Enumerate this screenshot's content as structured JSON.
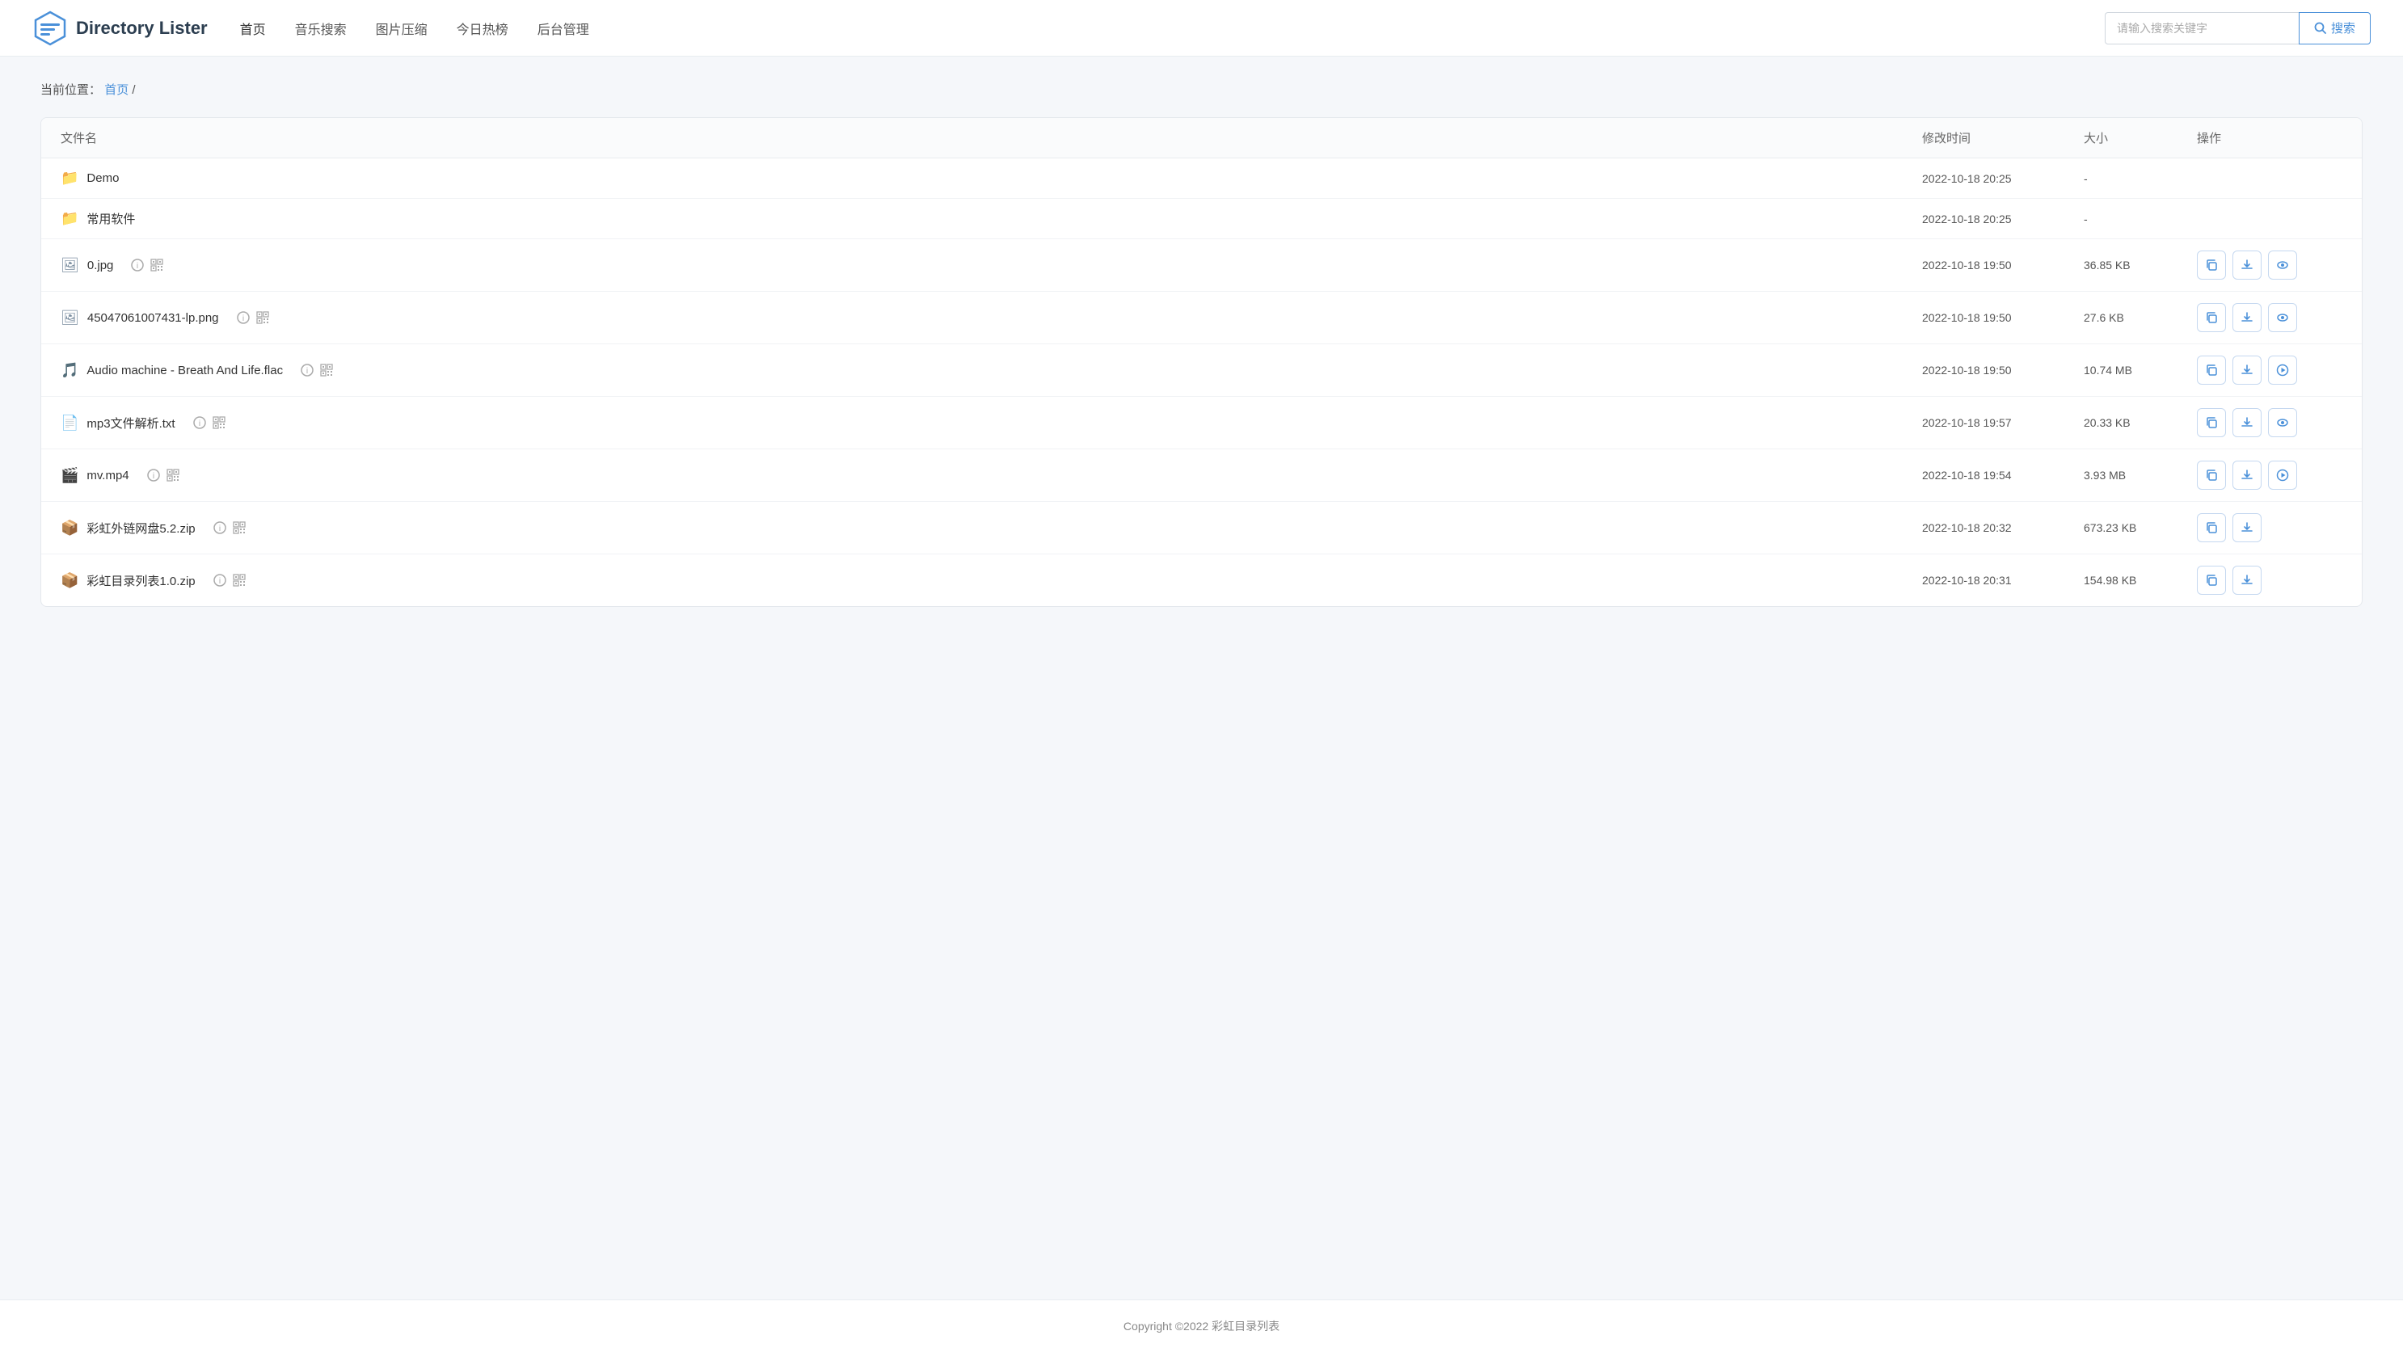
{
  "header": {
    "logo_text": "Directory Lister",
    "nav": {
      "items": [
        {
          "label": "首页",
          "active": true
        },
        {
          "label": "音乐搜索",
          "active": false
        },
        {
          "label": "图片压缩",
          "active": false
        },
        {
          "label": "今日热榜",
          "active": false
        },
        {
          "label": "后台管理",
          "active": false
        }
      ]
    },
    "search": {
      "placeholder": "请输入搜索关键字",
      "button_label": "搜索"
    }
  },
  "breadcrumb": {
    "prefix": "当前位置：",
    "home_link": "首页",
    "separator": " /"
  },
  "table": {
    "columns": {
      "name": "文件名",
      "modified": "修改时间",
      "size": "大小",
      "ops": "操作"
    },
    "rows": [
      {
        "type": "folder",
        "name": "Demo",
        "modified": "2022-10-18 20:25",
        "size": "-",
        "actions": []
      },
      {
        "type": "folder",
        "name": "常用软件",
        "modified": "2022-10-18 20:25",
        "size": "-",
        "actions": []
      },
      {
        "type": "image",
        "name": "0.jpg",
        "modified": "2022-10-18 19:50",
        "size": "36.85 KB",
        "actions": [
          "copy",
          "download",
          "preview"
        ]
      },
      {
        "type": "image",
        "name": "45047061007431-lp.png",
        "modified": "2022-10-18 19:50",
        "size": "27.6 KB",
        "actions": [
          "copy",
          "download",
          "preview"
        ]
      },
      {
        "type": "audio",
        "name": "Audio machine - Breath And Life.flac",
        "modified": "2022-10-18 19:50",
        "size": "10.74 MB",
        "actions": [
          "copy",
          "download",
          "play"
        ]
      },
      {
        "type": "text",
        "name": "mp3文件解析.txt",
        "modified": "2022-10-18 19:57",
        "size": "20.33 KB",
        "actions": [
          "copy",
          "download",
          "preview"
        ]
      },
      {
        "type": "video",
        "name": "mv.mp4",
        "modified": "2022-10-18 19:54",
        "size": "3.93 MB",
        "actions": [
          "copy",
          "download",
          "play"
        ]
      },
      {
        "type": "zip",
        "name": "彩虹外链网盘5.2.zip",
        "modified": "2022-10-18 20:32",
        "size": "673.23 KB",
        "actions": [
          "copy",
          "download"
        ]
      },
      {
        "type": "zip",
        "name": "彩虹目录列表1.0.zip",
        "modified": "2022-10-18 20:31",
        "size": "154.98 KB",
        "actions": [
          "copy",
          "download"
        ]
      }
    ]
  },
  "footer": {
    "text": "Copyright ©2022 彩虹目录列表"
  }
}
